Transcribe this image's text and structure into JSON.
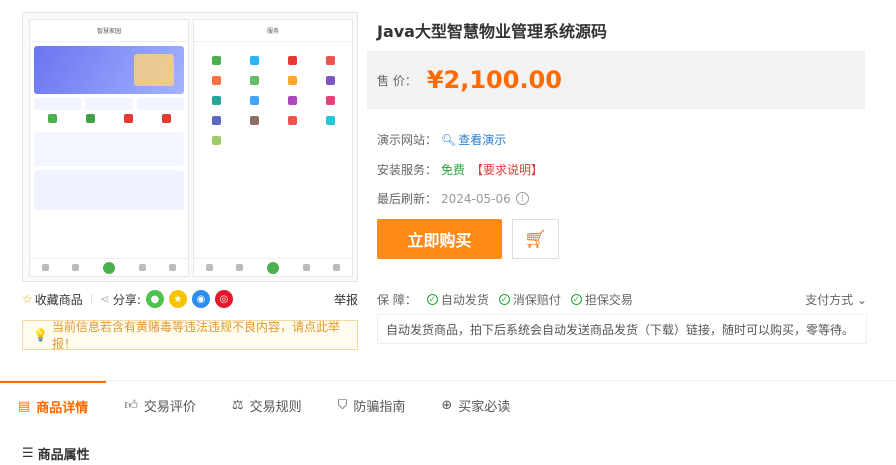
{
  "product": {
    "title": "Java大型智慧物业管理系统源码",
    "price_label": "售 价：",
    "price": "¥2,100.00",
    "demo_label": "演示网站：",
    "demo_link": "查看演示",
    "install_label": "安装服务：",
    "install_value": "免费",
    "install_note": "【要求说明】",
    "refresh_label": "最后刷新：",
    "refresh_date": "2024-05-06",
    "buy_label": "立即购买",
    "accent_color": "#ff6a00"
  },
  "gallery": {
    "phone1_title": "智慧家园",
    "phone2_title": "服务"
  },
  "share": {
    "favorite_label": "收藏商品",
    "share_label": "分享:",
    "report_label": "举报",
    "icons": [
      "wechat-icon",
      "qzone-icon",
      "qq-icon",
      "weibo-icon"
    ]
  },
  "notice": {
    "text": "当前信息若含有黄赌毒等违法违规不良内容，请点此举报！"
  },
  "guarantee": {
    "label": "保 障：",
    "tags": [
      "自动发货",
      "消保赔付",
      "担保交易"
    ],
    "pay_label": "支付方式",
    "description": "自动发货商品，拍下后系统会自动发送商品发货（下载）链接，随时可以购买，零等待。"
  },
  "tabs": [
    {
      "label": "商品详情",
      "icon": "list-icon"
    },
    {
      "label": "交易评价",
      "icon": "thumb-up-icon"
    },
    {
      "label": "交易规则",
      "icon": "scale-icon"
    },
    {
      "label": "防骗指南",
      "icon": "shield-icon"
    },
    {
      "label": "买家必读",
      "icon": "plus-circle-icon"
    }
  ],
  "section": {
    "title": "商品属性"
  }
}
